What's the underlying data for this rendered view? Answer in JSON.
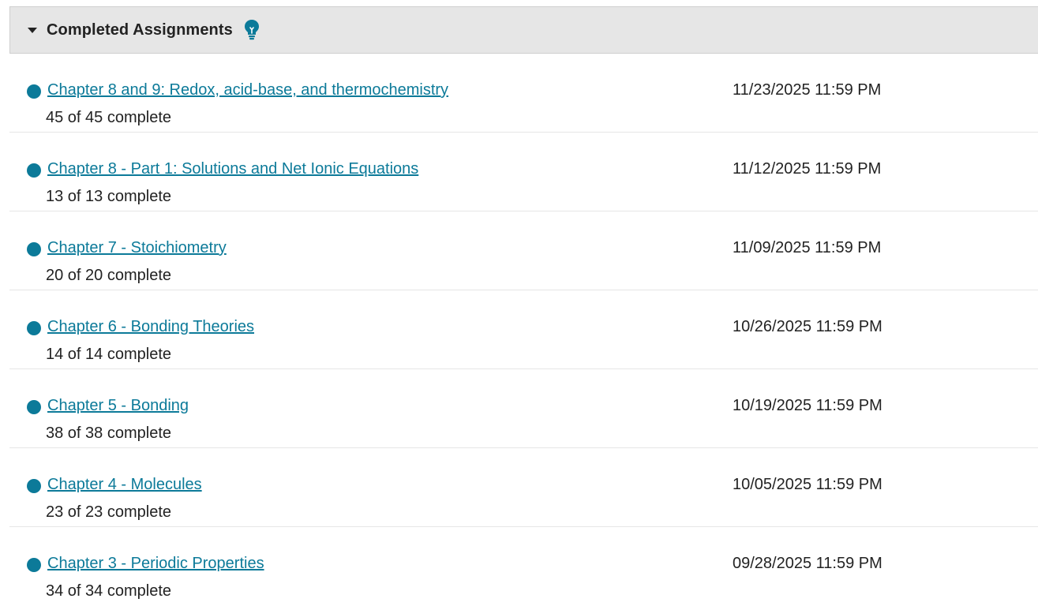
{
  "section": {
    "title": "Completed Assignments",
    "icons": {
      "collapse": "caret-down-icon",
      "tip": "lightbulb-icon"
    },
    "accent_color": "#0c7a99"
  },
  "assignments": [
    {
      "title": "Chapter 8 and 9: Redox, acid-base, and thermochemistry",
      "progress": "45 of 45 complete",
      "due": "11/23/2025 11:59 PM"
    },
    {
      "title": "Chapter 8 - Part 1: Solutions and Net Ionic Equations",
      "progress": "13 of 13 complete",
      "due": "11/12/2025 11:59 PM"
    },
    {
      "title": "Chapter 7 - Stoichiometry",
      "progress": "20 of 20 complete",
      "due": "11/09/2025 11:59 PM"
    },
    {
      "title": "Chapter 6 - Bonding Theories",
      "progress": "14 of 14 complete",
      "due": "10/26/2025 11:59 PM"
    },
    {
      "title": "Chapter 5 - Bonding",
      "progress": "38 of 38 complete",
      "due": "10/19/2025 11:59 PM"
    },
    {
      "title": "Chapter 4 - Molecules",
      "progress": "23 of 23 complete",
      "due": "10/05/2025 11:59 PM"
    },
    {
      "title": "Chapter 3 - Periodic Properties",
      "progress": "34 of 34 complete",
      "due": "09/28/2025 11:59 PM"
    }
  ]
}
